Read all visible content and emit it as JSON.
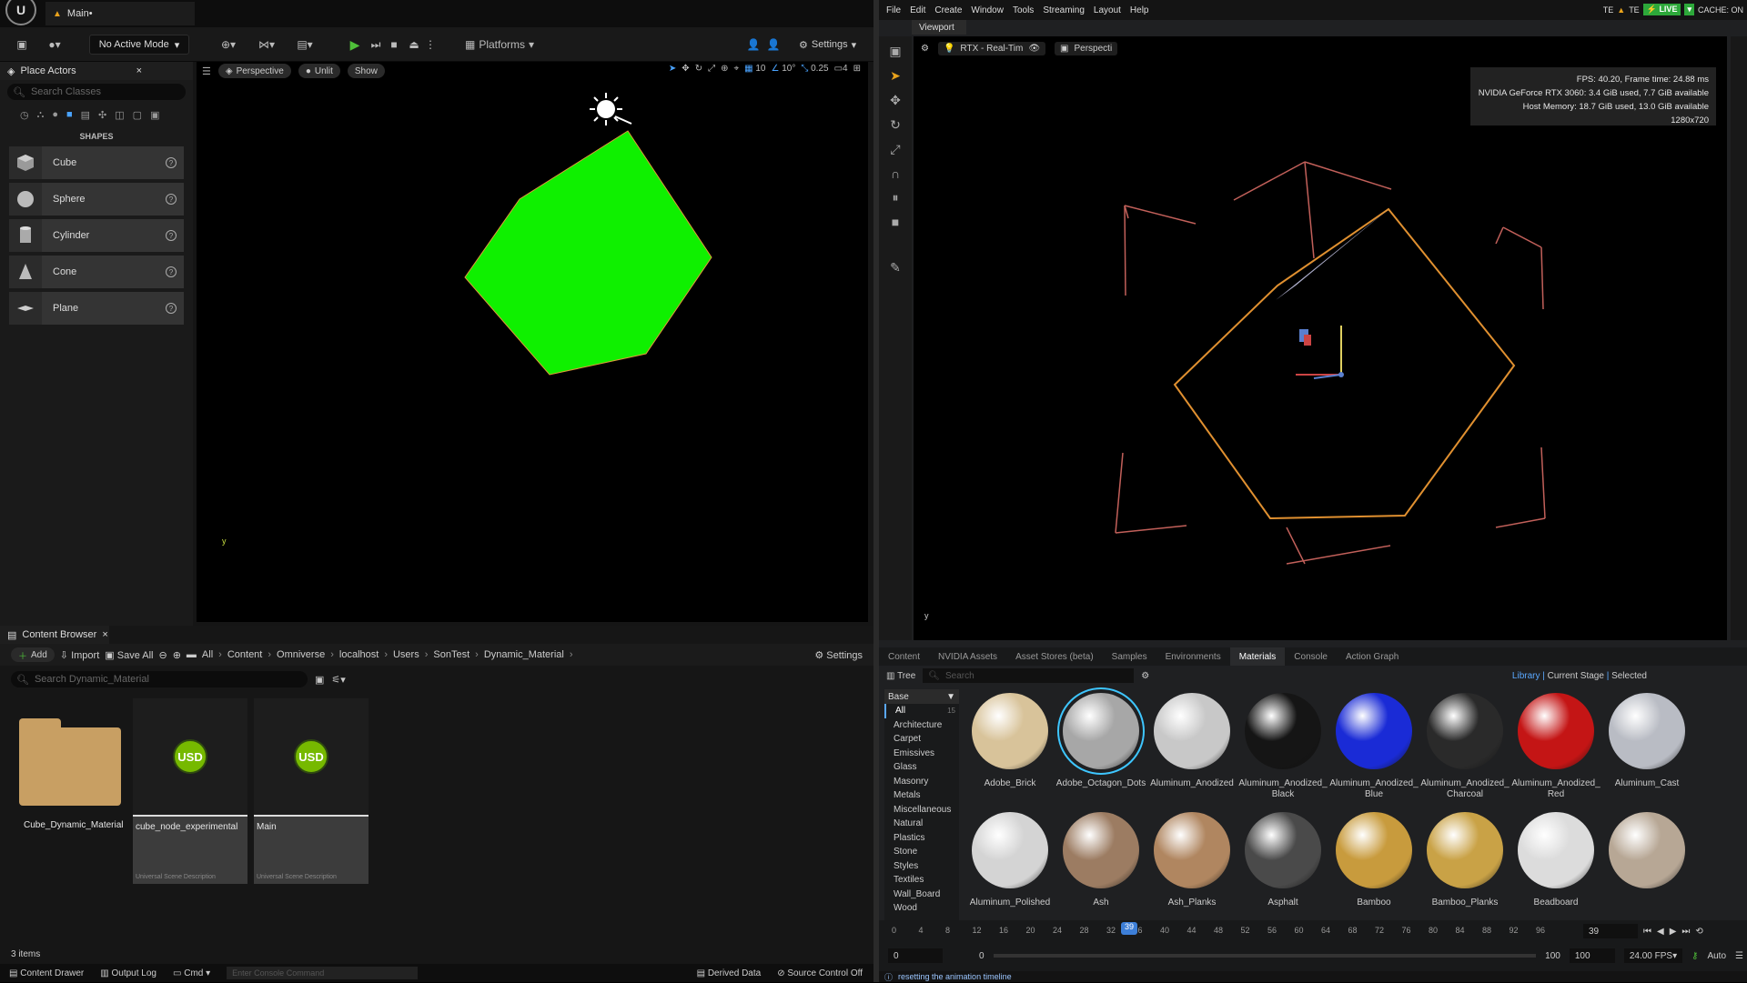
{
  "ue": {
    "doc_tab": "Main•",
    "mode": "No Active Mode",
    "platforms": "Platforms",
    "settings": "Settings",
    "place_actors": {
      "tab": "Place Actors",
      "search_placeholder": "Search Classes",
      "shapes_label": "SHAPES",
      "items": [
        "Cube",
        "Sphere",
        "Cylinder",
        "Cone",
        "Plane"
      ]
    },
    "viewport": {
      "perspective": "Perspective",
      "unlit": "Unlit",
      "show": "Show",
      "grid": "10",
      "angle": "10°",
      "scale": "0.25",
      "camera": "4"
    },
    "content_browser": {
      "tab": "Content Browser",
      "add": "Add",
      "import": "Import",
      "save_all": "Save All",
      "settings": "Settings",
      "path": [
        "All",
        "Content",
        "Omniverse",
        "localhost",
        "Users",
        "SonTest",
        "Dynamic_Material"
      ],
      "search_placeholder": "Search Dynamic_Material",
      "assets": [
        {
          "name": "Cube_Dynamic_Material",
          "type": ""
        },
        {
          "name": "cube_node_experimental",
          "type": "Universal Scene Description"
        },
        {
          "name": "Main",
          "type": "Universal Scene Description"
        }
      ],
      "usd_label": "USD",
      "items_count": "3 items"
    },
    "statusbar": {
      "content_drawer": "Content Drawer",
      "output_log": "Output Log",
      "cmd": "Cmd",
      "console_placeholder": "Enter Console Command",
      "derived_data": "Derived Data",
      "source_control": "Source Control Off"
    }
  },
  "ov": {
    "menu": [
      "File",
      "Edit",
      "Create",
      "Window",
      "Tools",
      "Streaming",
      "Layout",
      "Help"
    ],
    "status": {
      "te1": "TE",
      "te2": "TE",
      "live": "LIVE",
      "cache": "CACHE: ON"
    },
    "viewport_tab": "Viewport",
    "render_mode": "RTX - Real-Tim",
    "camera": "Perspecti",
    "stats": {
      "fps": "FPS: 40.20, Frame time: 24.88 ms",
      "gpu": "NVIDIA GeForce RTX 3060: 3.4 GiB used, 7.7 GiB available",
      "host": "Host Memory: 18.7 GiB used, 13.0 GiB available",
      "res": "1280x720"
    },
    "bottom_tabs": [
      "Content",
      "NVIDIA Assets",
      "Asset Stores (beta)",
      "Samples",
      "Environments",
      "Materials",
      "Console",
      "Action Graph"
    ],
    "active_tab": "Materials",
    "tree_label": "Tree",
    "search_placeholder": "Search",
    "library": "Library",
    "current_stage": "Current Stage",
    "selected": "Selected",
    "tree_head": "Base",
    "tree": [
      {
        "name": "All",
        "count": "15"
      },
      {
        "name": "Architecture",
        "count": ""
      },
      {
        "name": "Carpet",
        "count": ""
      },
      {
        "name": "Emissives",
        "count": ""
      },
      {
        "name": "Glass",
        "count": ""
      },
      {
        "name": "Masonry",
        "count": ""
      },
      {
        "name": "Metals",
        "count": ""
      },
      {
        "name": "Miscellaneous",
        "count": ""
      },
      {
        "name": "Natural",
        "count": ""
      },
      {
        "name": "Plastics",
        "count": ""
      },
      {
        "name": "Stone",
        "count": ""
      },
      {
        "name": "Styles",
        "count": ""
      },
      {
        "name": "Textiles",
        "count": ""
      },
      {
        "name": "Wall_Board",
        "count": ""
      },
      {
        "name": "Wood",
        "count": ""
      }
    ],
    "materials": [
      {
        "name": "Adobe_Brick",
        "color": "#d8c39a"
      },
      {
        "name": "Adobe_Octagon_Dots",
        "color": "#a7a7a7"
      },
      {
        "name": "Aluminum_Anodized",
        "color": "#c8c8c8"
      },
      {
        "name": "Aluminum_Anodized_\nBlack",
        "color": "#151515"
      },
      {
        "name": "Aluminum_Anodized_\nBlue",
        "color": "#1a2bd6"
      },
      {
        "name": "Aluminum_Anodized_\nCharcoal",
        "color": "#2a2a2a"
      },
      {
        "name": "Aluminum_Anodized_\nRed",
        "color": "#c41515"
      },
      {
        "name": "Aluminum_Cast",
        "color": "#b9bcc4"
      },
      {
        "name": "Aluminum_Polished",
        "color": "#d4d4d4"
      },
      {
        "name": "Ash",
        "color": "#9c7c62"
      },
      {
        "name": "Ash_Planks",
        "color": "#b08660"
      },
      {
        "name": "Asphalt",
        "color": "#4a4a4a"
      },
      {
        "name": "Bamboo",
        "color": "#c89b3d"
      },
      {
        "name": "Bamboo_Planks",
        "color": "#c9a246"
      },
      {
        "name": "Beadboard",
        "color": "#dcdcdc"
      },
      {
        "name": "",
        "color": "#b7a795"
      }
    ],
    "timeline": {
      "ticks": [
        "0",
        "4",
        "8",
        "12",
        "16",
        "20",
        "24",
        "28",
        "32",
        "36",
        "40",
        "44",
        "48",
        "52",
        "56",
        "60",
        "64",
        "68",
        "72",
        "76",
        "80",
        "84",
        "88",
        "92",
        "96"
      ],
      "current": "39",
      "frame_field": "39",
      "start": "0",
      "start2": "0",
      "end": "100",
      "end2": "100",
      "fps": "24.00 FPS",
      "auto": "Auto"
    },
    "footer_msg": "resetting the animation timeline"
  }
}
